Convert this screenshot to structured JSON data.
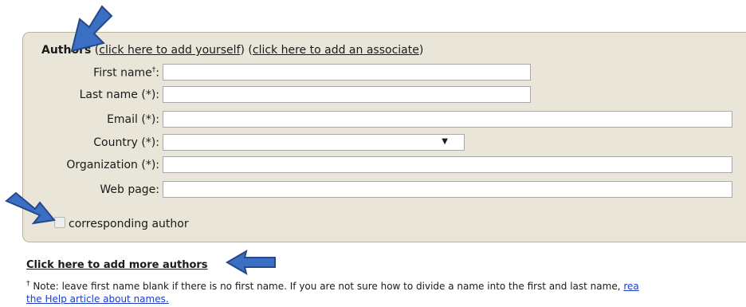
{
  "authors": {
    "heading": "Authors",
    "paren_open_1": "(",
    "add_yourself_link": "click here to add yourself",
    "paren_close_1": ")",
    "paren_open_2": "(",
    "add_associate_link": "click here to add an associate",
    "paren_close_2": ")"
  },
  "form": {
    "first_name_label": "First name",
    "first_name_mark": "†",
    "first_name_colon": ":",
    "first_name_value": "",
    "last_name_label": "Last name (*):",
    "last_name_value": "",
    "email_label": "Email (*):",
    "email_value": "",
    "country_label": "Country (*):",
    "country_selected": "",
    "organization_label": "Organization (*):",
    "organization_value": "",
    "web_page_label": "Web page:",
    "web_page_value": ""
  },
  "corresponding_author": {
    "label": "corresponding author",
    "checked": false
  },
  "add_more_authors": "Click here to add more authors",
  "note": {
    "mark": "†",
    "text": " Note: leave first name blank if there is no first name. If you are not sure how to divide a name into the first and last name, ",
    "link_line1": "rea",
    "link_line2": "the Help article about names."
  },
  "icons": {
    "select_arrow": "▼",
    "annotation_arrow_color": "#3a6fc4"
  }
}
